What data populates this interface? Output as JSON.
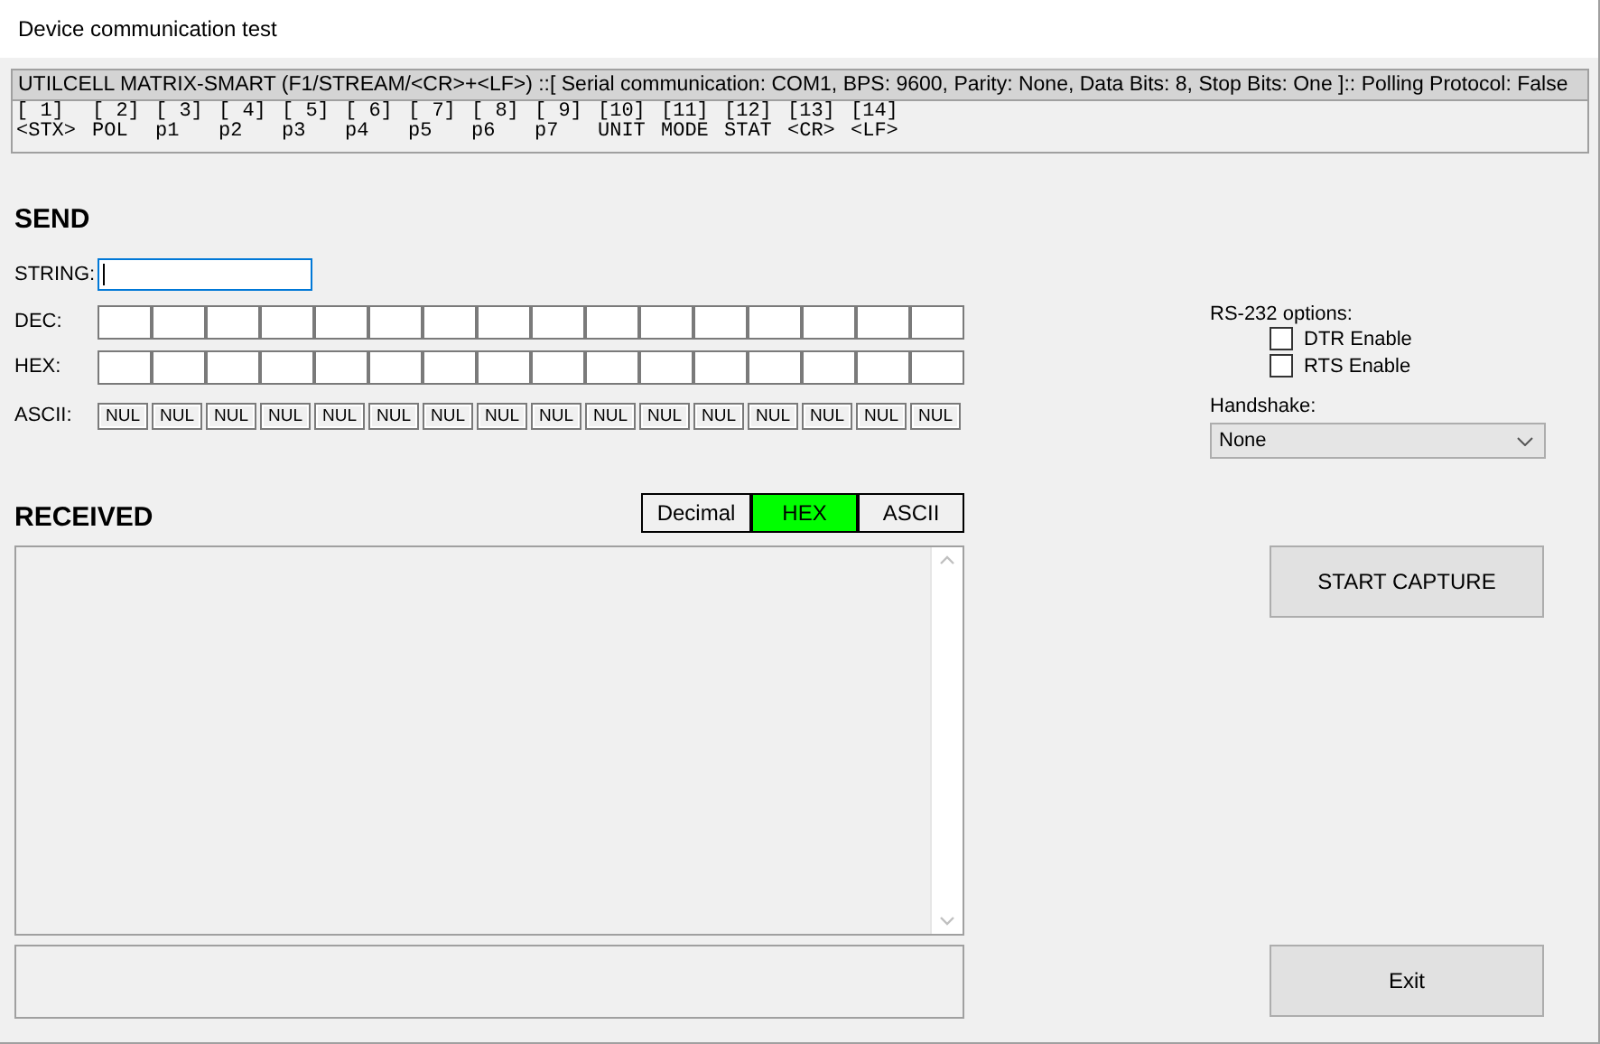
{
  "window": {
    "title": "Device communication test"
  },
  "protocol": {
    "header": "UTILCELL MATRIX-SMART (F1/STREAM/<CR>+<LF>) ::[ Serial communication: COM1, BPS: 9600, Parity: None, Data Bits: 8, Stop Bits: One ]:: Polling Protocol: False",
    "fields": [
      {
        "index": "[ 1]",
        "label": "<STX>"
      },
      {
        "index": "[ 2]",
        "label": "POL"
      },
      {
        "index": "[ 3]",
        "label": "p1"
      },
      {
        "index": "[ 4]",
        "label": "p2"
      },
      {
        "index": "[ 5]",
        "label": "p3"
      },
      {
        "index": "[ 6]",
        "label": "p4"
      },
      {
        "index": "[ 7]",
        "label": "p5"
      },
      {
        "index": "[ 8]",
        "label": "p6"
      },
      {
        "index": "[ 9]",
        "label": "p7"
      },
      {
        "index": "[10]",
        "label": "UNIT"
      },
      {
        "index": "[11]",
        "label": "MODE"
      },
      {
        "index": "[12]",
        "label": "STAT"
      },
      {
        "index": "[13]",
        "label": "<CR>"
      },
      {
        "index": "[14]",
        "label": "<LF>"
      }
    ]
  },
  "send": {
    "title": "SEND",
    "string_label": "STRING:",
    "string_focused": true,
    "dec_label": "DEC:",
    "hex_label": "HEX:",
    "ascii_label": "ASCII:",
    "ascii": [
      "NUL",
      "NUL",
      "NUL",
      "NUL",
      "NUL",
      "NUL",
      "NUL",
      "NUL",
      "NUL",
      "NUL",
      "NUL",
      "NUL",
      "NUL",
      "NUL",
      "NUL",
      "NUL"
    ]
  },
  "received": {
    "title": "RECEIVED",
    "modes": [
      {
        "label": "Decimal",
        "selected": false
      },
      {
        "label": "HEX",
        "selected": true
      },
      {
        "label": "ASCII",
        "selected": false
      }
    ]
  },
  "rs232": {
    "title": "RS-232 options:",
    "options": [
      {
        "label": "DTR Enable",
        "checked": false
      },
      {
        "label": "RTS Enable",
        "checked": false
      }
    ]
  },
  "handshake": {
    "label": "Handshake:",
    "value": "None"
  },
  "buttons": {
    "capture": "START CAPTURE",
    "exit": "Exit"
  }
}
